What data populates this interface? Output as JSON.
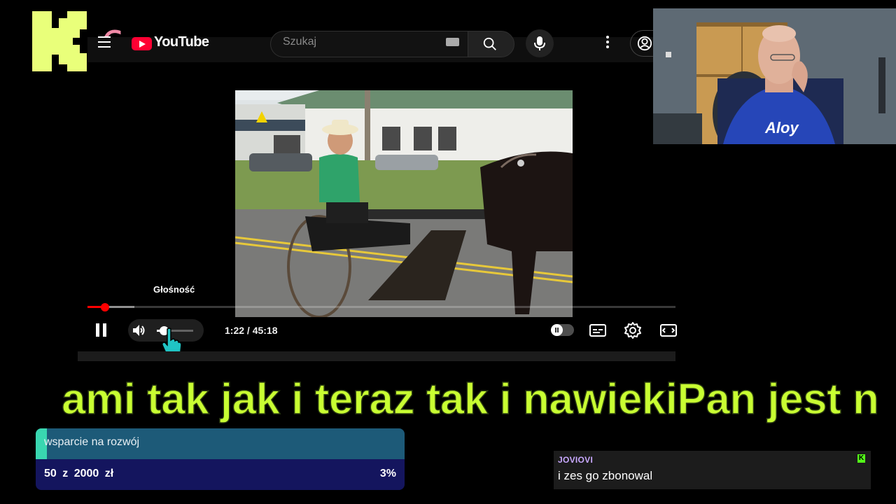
{
  "overlay": {
    "kick_logo_letter": "K",
    "number_badge": "6"
  },
  "youtube": {
    "logo_text": "YouTube",
    "search": {
      "placeholder": "Szukaj"
    }
  },
  "player": {
    "volume_tooltip": "Głośność",
    "time": "1:22 / 45:18",
    "progress": {
      "played_fraction": 0.03,
      "buffered_fraction": 0.08
    },
    "volume_level": 0.2,
    "autoplay": true
  },
  "ticker": {
    "text": "ami tak jak i teraz tak i nawiekiPan jest n",
    "color": "#c8ff32"
  },
  "donation_goal": {
    "label": "wsparcie na rozwój",
    "current": "50",
    "separator": "z",
    "target": "2000",
    "currency": "zł",
    "percent_text": "3%",
    "percent": 0.03,
    "colors": {
      "top": "#1d5a78",
      "fill": "#39d6b0",
      "bottom": "#14155e"
    }
  },
  "chat": {
    "username": "JOVIOVI",
    "message": "i zes go zbonowal",
    "badge": "K",
    "username_color": "#c9a9ff"
  },
  "icons": [
    "hamburger-icon",
    "youtube-logo-icon",
    "keyboard-icon",
    "search-icon",
    "mic-icon",
    "more-vert-icon",
    "account-icon",
    "pause-icon",
    "volume-icon",
    "hand-cursor-icon",
    "subtitles-icon",
    "settings-icon",
    "theater-mode-icon"
  ]
}
